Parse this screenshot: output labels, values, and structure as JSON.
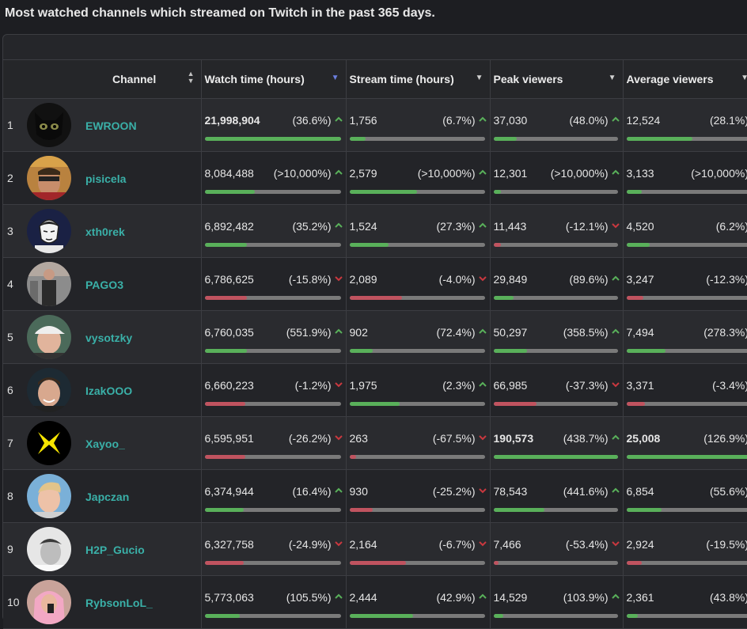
{
  "title": "Most watched channels which streamed on Twitch in the past 365 days.",
  "headers": {
    "channel": "Channel",
    "watch": "Watch time (hours)",
    "stream": "Stream time (hours)",
    "peak": "Peak viewers",
    "avg": "Average viewers"
  },
  "colors": {
    "up": "#59b05a",
    "down": "#c0535f",
    "channel": "#3ab0a8"
  },
  "rows": [
    {
      "rank": "1",
      "name": "EWROON",
      "avatar": "black-cat",
      "watch": {
        "v": "21,998,904",
        "p": "(36.6%)",
        "dir": "up",
        "bold": true,
        "fill": 1.0
      },
      "stream": {
        "v": "1,756",
        "p": "(6.7%)",
        "dir": "up",
        "fill": 0.12
      },
      "peak": {
        "v": "37,030",
        "p": "(48.0%)",
        "dir": "up",
        "fill": 0.19
      },
      "avg": {
        "v": "12,524",
        "p": "(28.1%)",
        "dir": "up",
        "fill": 0.5
      }
    },
    {
      "rank": "2",
      "name": "pisicela",
      "avatar": "man-sunglasses",
      "watch": {
        "v": "8,084,488",
        "p": "(>10,000%)",
        "dir": "up",
        "fill": 0.37
      },
      "stream": {
        "v": "2,579",
        "p": "(>10,000%)",
        "dir": "up",
        "fill": 0.5
      },
      "peak": {
        "v": "12,301",
        "p": "(>10,000%)",
        "dir": "up",
        "fill": 0.06
      },
      "avg": {
        "v": "3,133",
        "p": "(>10,000%)",
        "dir": "up",
        "fill": 0.12
      }
    },
    {
      "rank": "3",
      "name": "xth0rek",
      "avatar": "cartoon-face",
      "watch": {
        "v": "6,892,482",
        "p": "(35.2%)",
        "dir": "up",
        "fill": 0.31
      },
      "stream": {
        "v": "1,524",
        "p": "(27.3%)",
        "dir": "up",
        "fill": 0.29
      },
      "peak": {
        "v": "11,443",
        "p": "(-12.1%)",
        "dir": "down",
        "fill": 0.06
      },
      "avg": {
        "v": "4,520",
        "p": "(6.2%)",
        "dir": "up",
        "fill": 0.18
      }
    },
    {
      "rank": "4",
      "name": "PAGO3",
      "avatar": "man-standing",
      "watch": {
        "v": "6,786,625",
        "p": "(-15.8%)",
        "dir": "down",
        "fill": 0.31
      },
      "stream": {
        "v": "2,089",
        "p": "(-4.0%)",
        "dir": "down",
        "fill": 0.39
      },
      "peak": {
        "v": "29,849",
        "p": "(89.6%)",
        "dir": "up",
        "fill": 0.16
      },
      "avg": {
        "v": "3,247",
        "p": "(-12.3%)",
        "dir": "down",
        "fill": 0.13
      }
    },
    {
      "rank": "5",
      "name": "vysotzky",
      "avatar": "man-cap",
      "watch": {
        "v": "6,760,035",
        "p": "(551.9%)",
        "dir": "up",
        "fill": 0.31
      },
      "stream": {
        "v": "902",
        "p": "(72.4%)",
        "dir": "up",
        "fill": 0.17
      },
      "peak": {
        "v": "50,297",
        "p": "(358.5%)",
        "dir": "up",
        "fill": 0.27
      },
      "avg": {
        "v": "7,494",
        "p": "(278.3%)",
        "dir": "up",
        "fill": 0.3
      }
    },
    {
      "rank": "6",
      "name": "IzakOOO",
      "avatar": "man-smile",
      "watch": {
        "v": "6,660,223",
        "p": "(-1.2%)",
        "dir": "down",
        "fill": 0.3
      },
      "stream": {
        "v": "1,975",
        "p": "(2.3%)",
        "dir": "up",
        "fill": 0.37
      },
      "peak": {
        "v": "66,985",
        "p": "(-37.3%)",
        "dir": "down",
        "fill": 0.35
      },
      "avg": {
        "v": "3,371",
        "p": "(-3.4%)",
        "dir": "down",
        "fill": 0.14
      }
    },
    {
      "rank": "7",
      "name": "Xayoo_",
      "avatar": "yellow-logo",
      "watch": {
        "v": "6,595,951",
        "p": "(-26.2%)",
        "dir": "down",
        "fill": 0.3
      },
      "stream": {
        "v": "263",
        "p": "(-67.5%)",
        "dir": "down",
        "fill": 0.05
      },
      "peak": {
        "v": "190,573",
        "p": "(438.7%)",
        "dir": "up",
        "bold": true,
        "fill": 1.0
      },
      "avg": {
        "v": "25,008",
        "p": "(126.9%)",
        "dir": "up",
        "bold": true,
        "fill": 1.0
      }
    },
    {
      "rank": "8",
      "name": "Japczan",
      "avatar": "blond-man",
      "watch": {
        "v": "6,374,944",
        "p": "(16.4%)",
        "dir": "up",
        "fill": 0.29
      },
      "stream": {
        "v": "930",
        "p": "(-25.2%)",
        "dir": "down",
        "fill": 0.17
      },
      "peak": {
        "v": "78,543",
        "p": "(441.6%)",
        "dir": "up",
        "fill": 0.41
      },
      "avg": {
        "v": "6,854",
        "p": "(55.6%)",
        "dir": "up",
        "fill": 0.27
      }
    },
    {
      "rank": "9",
      "name": "H2P_Gucio",
      "avatar": "bw-portrait",
      "watch": {
        "v": "6,327,758",
        "p": "(-24.9%)",
        "dir": "down",
        "fill": 0.29
      },
      "stream": {
        "v": "2,164",
        "p": "(-6.7%)",
        "dir": "down",
        "fill": 0.42
      },
      "peak": {
        "v": "7,466",
        "p": "(-53.4%)",
        "dir": "down",
        "fill": 0.04
      },
      "avg": {
        "v": "2,924",
        "p": "(-19.5%)",
        "dir": "down",
        "fill": 0.12
      }
    },
    {
      "rank": "10",
      "name": "RybsonLoL_",
      "avatar": "pink-hoodie",
      "watch": {
        "v": "5,773,063",
        "p": "(105.5%)",
        "dir": "up",
        "fill": 0.26
      },
      "stream": {
        "v": "2,444",
        "p": "(42.9%)",
        "dir": "up",
        "fill": 0.47
      },
      "peak": {
        "v": "14,529",
        "p": "(103.9%)",
        "dir": "up",
        "fill": 0.08
      },
      "avg": {
        "v": "2,361",
        "p": "(43.8%)",
        "dir": "up",
        "fill": 0.09
      }
    }
  ]
}
